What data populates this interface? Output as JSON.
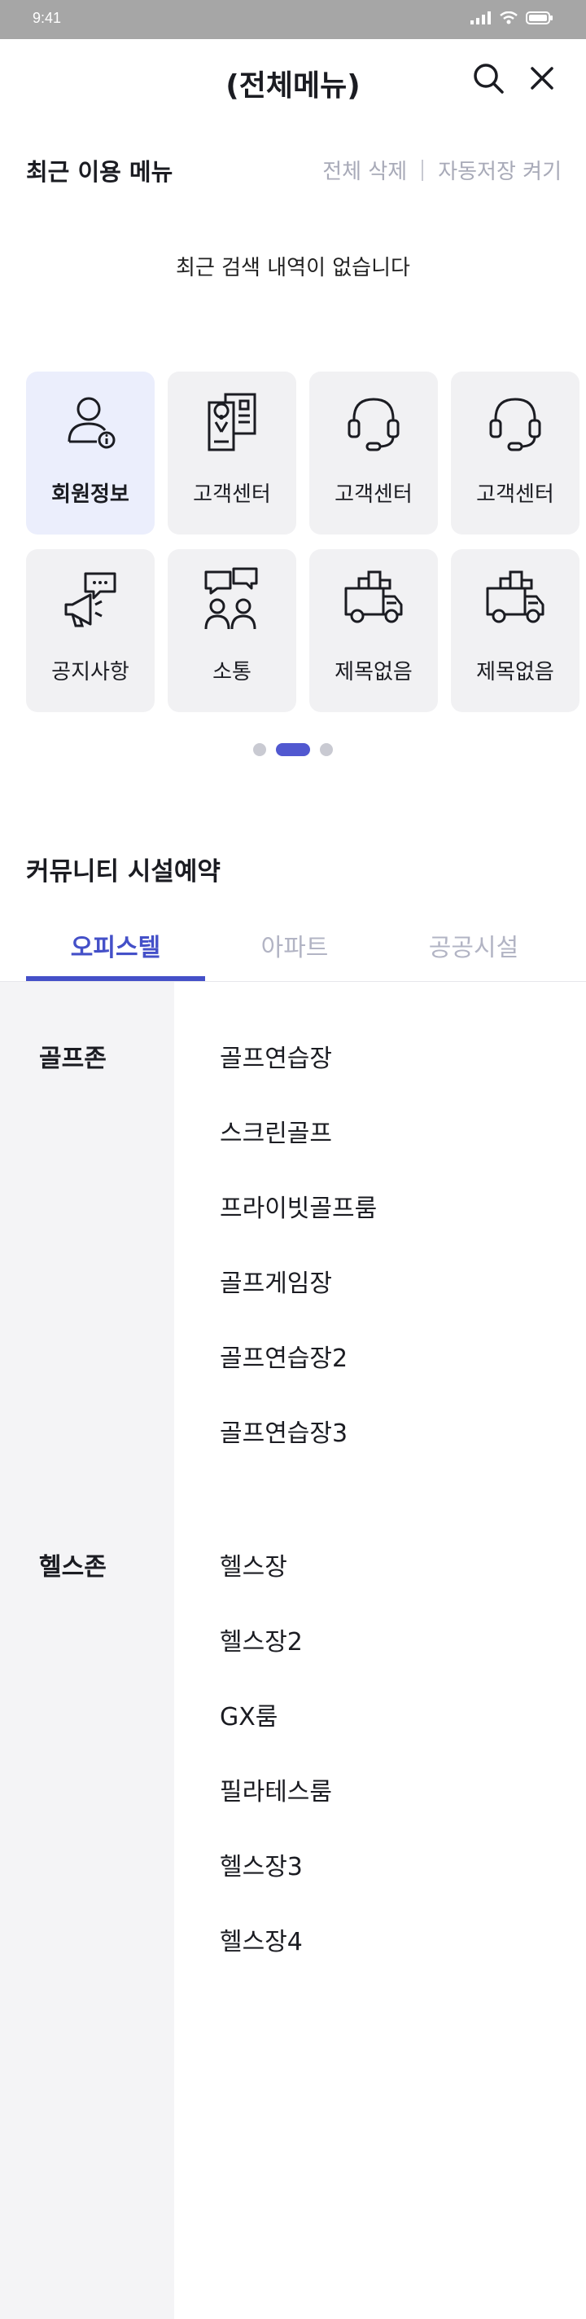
{
  "status": {
    "time": "9:41"
  },
  "header": {
    "title": "(전체메뉴)"
  },
  "recent": {
    "title": "최근 이용 메뉴",
    "delete_all": "전체 삭제",
    "autosave": "자동저장 켜기",
    "empty_message": "최근 검색 내역이 없습니다"
  },
  "menu_tiles": [
    {
      "label": "회원정보",
      "icon": "member-info-icon",
      "active": true
    },
    {
      "label": "고객센터",
      "icon": "document-map-icon",
      "active": false
    },
    {
      "label": "고객센터",
      "icon": "headset-icon",
      "active": false
    },
    {
      "label": "고객센터",
      "icon": "headset-icon",
      "active": false
    },
    {
      "label": "공지사항",
      "icon": "megaphone-chat-icon",
      "active": false
    },
    {
      "label": "소통",
      "icon": "people-chat-icon",
      "active": false
    },
    {
      "label": "제목없음",
      "icon": "delivery-truck-icon",
      "active": false
    },
    {
      "label": "제목없음",
      "icon": "delivery-truck-icon",
      "active": false
    }
  ],
  "pager": {
    "pages": 3,
    "current": 2
  },
  "community": {
    "title": "커뮤니티 시설예약",
    "tabs": [
      "오피스텔",
      "아파트",
      "공공시설"
    ],
    "active_tab": 0,
    "categories": [
      {
        "name": "골프존",
        "items": [
          "골프연습장",
          "스크린골프",
          "프라이빗골프룸",
          "골프게임장",
          "골프연습장2",
          "골프연습장3"
        ]
      },
      {
        "name": "헬스존",
        "items": [
          "헬스장",
          "헬스장2",
          "GX룸",
          "필라테스룸",
          "헬스장3",
          "헬스장4"
        ]
      }
    ]
  },
  "colors": {
    "accent": "#4450c8",
    "tile_bg": "#f1f1f3",
    "tile_active_bg": "#ebeefc",
    "side_bg": "#f4f4f6"
  }
}
